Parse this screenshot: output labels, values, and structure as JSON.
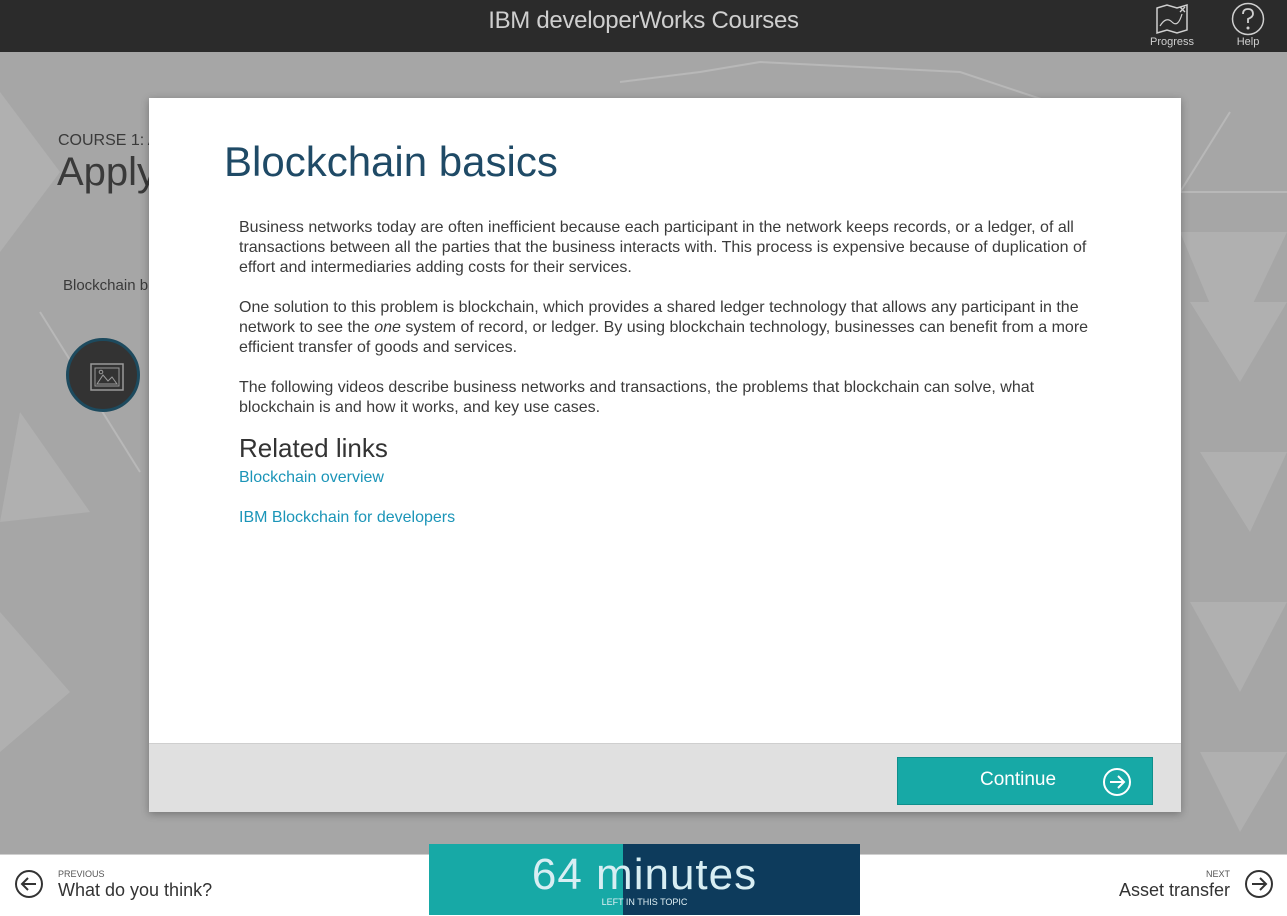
{
  "app": {
    "title": "IBM developerWorks Courses",
    "progress_label": "Progress",
    "help_label": "Help"
  },
  "background": {
    "course_label": "COURSE 1: A",
    "page_title": "Apply",
    "tab_label": "Blockchain b"
  },
  "modal": {
    "title": "Blockchain basics",
    "paragraphs": {
      "p1": "Business networks today are often inefficient because each participant in the network keeps records, or a ledger, of all transactions between all the parties that the business interacts with. This process is expensive because of duplication of effort and intermediaries adding costs for their services.",
      "p2_before": "One solution to this problem is blockchain, which provides a shared ledger technology that allows any participant in the network to see the ",
      "p2_em": "one",
      "p2_after": " system of record, or ledger. By using blockchain technology, businesses can benefit from a more efficient transfer of goods and services.",
      "p3": "The following videos describe business networks and transactions, the problems that blockchain can solve, what blockchain is and how it works, and key use cases."
    },
    "related_heading": "Related links",
    "links": [
      "Blockchain overview",
      "IBM Blockchain for developers"
    ],
    "continue_label": "Continue"
  },
  "footer": {
    "prev_small": "PREVIOUS",
    "prev_title": "What do you think?",
    "next_small": "NEXT",
    "next_title": "Asset transfer",
    "timer_value": "64 minutes",
    "timer_caption": "LEFT IN THIS TOPIC",
    "timer_progress": 0.45
  },
  "colors": {
    "accent": "#17a9a6",
    "dark_blue": "#0d3b5c",
    "link": "#1b95b8",
    "title": "#1f4a66"
  }
}
